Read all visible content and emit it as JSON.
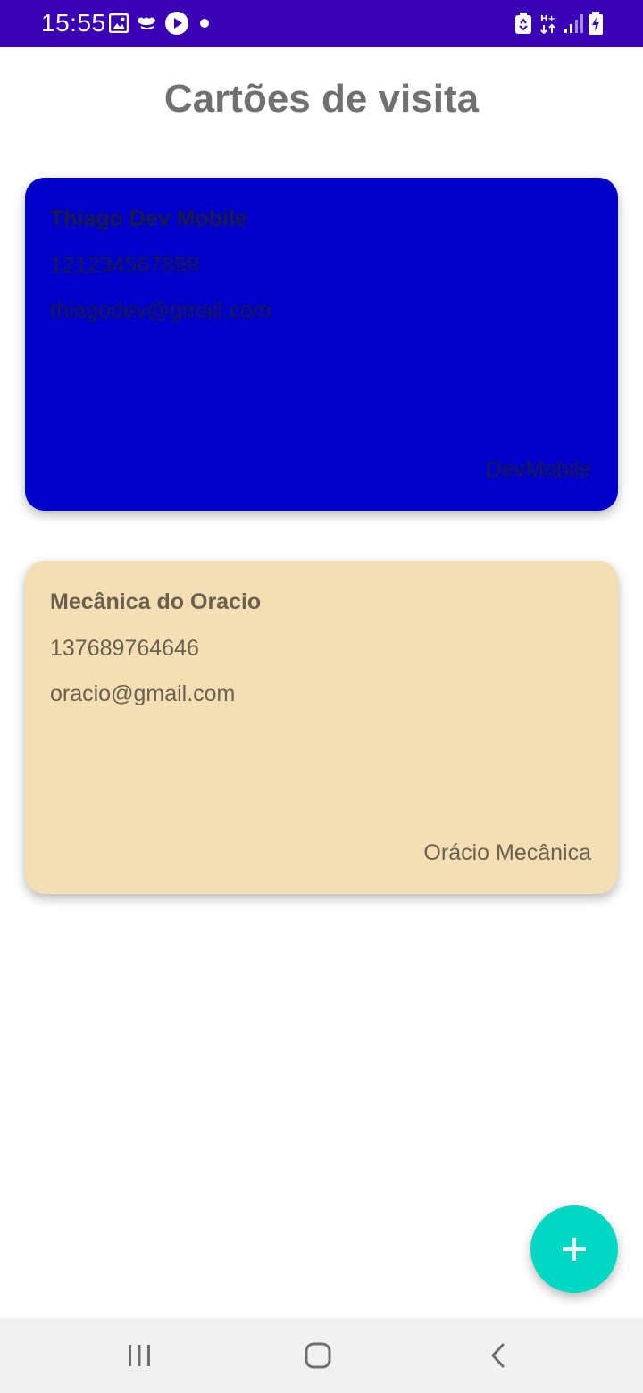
{
  "status_bar": {
    "time": "15:55",
    "background": "#3a00b4",
    "left_icons": [
      "image-icon",
      "ifood-icon",
      "play-icon",
      "notification-dot"
    ],
    "right_icons": [
      "recycle-icon",
      "data-hplus-icon",
      "signal-icon",
      "battery-charging-icon"
    ]
  },
  "page": {
    "title": "Cartões de visita"
  },
  "cards": [
    {
      "name": "Thiago Dev Mobile",
      "phone": "121234567899",
      "email": "thiagodev@gmail.com",
      "company": "DevMobile",
      "background": "#0000c8",
      "text_color": "#1a1a4a"
    },
    {
      "name": "Mecânica do Oracio",
      "phone": "137689764646",
      "email": "oracio@gmail.com",
      "company": "Orácio Mecânica",
      "background": "#f4deb4",
      "text_color": "#6b5f4d"
    }
  ],
  "fab": {
    "icon": "plus-icon",
    "color": "#00d8c4"
  },
  "nav_bar": {
    "buttons": [
      "recent-apps-icon",
      "home-icon",
      "back-icon"
    ]
  }
}
